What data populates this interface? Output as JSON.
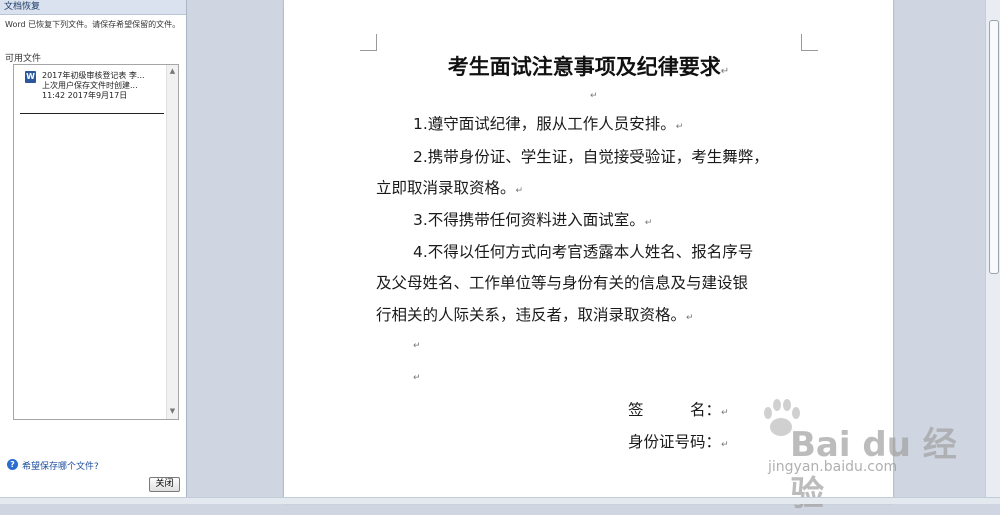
{
  "recovery_pane": {
    "header": "文档恢复",
    "description": "Word 已恢复下列文件。请保存希望保留的文件。",
    "available_label": "可用文件",
    "file": {
      "name": "2017年初级审核登记表 李...",
      "subtitle": "上次用户保存文件时创建...",
      "datetime": "11:42 2017年9月17日"
    },
    "help_link": "希望保存哪个文件?",
    "close_button": "关闭"
  },
  "document": {
    "title": "考生面试注意事项及纪律要求",
    "lines": [
      "1.遵守面试纪律，服从工作人员安排。",
      "2.携带身份证、学生证，自觉接受验证，考生舞弊，",
      "立即取消录取资格。",
      "3.不得携带任何资料进入面试室。",
      "4.不得以任何方式向考官透露本人姓名、报名序号",
      "及父母姓名、工作单位等与身份有关的信息及与建设银",
      "行相关的人际关系，违反者，取消录取资格。"
    ],
    "sign_label": "签　　　名：",
    "id_label": "身份证号码：",
    "paragraph_mark": "↵"
  },
  "watermark": {
    "brand": "Bai du 经验",
    "url": "jingyan.baidu.com"
  },
  "colors": {
    "accent": "#2b579a",
    "pane_header": "#d9e2ee",
    "workspace": "#cfd6e1"
  }
}
